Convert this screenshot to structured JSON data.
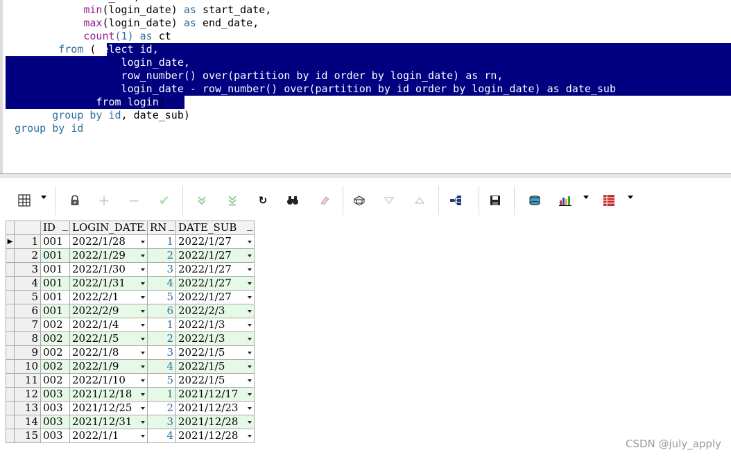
{
  "editor": {
    "lines": [
      {
        "segs": [
          {
            "t": "            date_sub,",
            "c": "tx"
          }
        ]
      },
      {
        "segs": [
          {
            "t": "            ",
            "c": "tx"
          },
          {
            "t": "min",
            "c": "fn"
          },
          {
            "t": "(login_date) ",
            "c": "tx"
          },
          {
            "t": "as",
            "c": "kw"
          },
          {
            "t": " start_date,",
            "c": "tx"
          }
        ]
      },
      {
        "segs": [
          {
            "t": "            ",
            "c": "tx"
          },
          {
            "t": "max",
            "c": "fn"
          },
          {
            "t": "(login_date) ",
            "c": "tx"
          },
          {
            "t": "as",
            "c": "kw"
          },
          {
            "t": " end_date,",
            "c": "tx"
          }
        ]
      },
      {
        "segs": [
          {
            "t": "            ",
            "c": "tx"
          },
          {
            "t": "count",
            "c": "fn"
          },
          {
            "t": "(1) ",
            "c": "num"
          },
          {
            "t": "as",
            "c": "kw"
          },
          {
            "t": " ct",
            "c": "tx"
          }
        ]
      },
      {
        "segs": [
          {
            "t": "        ",
            "c": "tx"
          },
          {
            "t": "from",
            "c": "kw"
          },
          {
            "t": " (",
            "c": "tx"
          },
          {
            "t": "select",
            "c": "kw"
          },
          {
            "t": " id,",
            "c": "tx"
          }
        ]
      },
      {
        "segs": [
          {
            "t": "                  login_date,",
            "c": "tx"
          }
        ]
      },
      {
        "segs": [
          {
            "t": "                  row_number() over(partition by id order by login_date) as rn,",
            "c": "tx"
          }
        ]
      },
      {
        "segs": [
          {
            "t": "                  login_date - row_number() over(partition by id order by login_date) as date_sub",
            "c": "tx"
          }
        ]
      },
      {
        "segs": [
          {
            "t": "              ",
            "c": "tx"
          },
          {
            "t": "from",
            "c": "kw"
          },
          {
            "t": " login)",
            "c": "tx"
          }
        ]
      },
      {
        "segs": [
          {
            "t": "       ",
            "c": "tx"
          },
          {
            "t": "group by",
            "c": "kw"
          },
          {
            "t": " ",
            "c": "tx"
          },
          {
            "t": "id",
            "c": "kw"
          },
          {
            "t": ", date_sub)",
            "c": "tx"
          }
        ]
      },
      {
        "segs": [
          {
            "t": " ",
            "c": "tx"
          },
          {
            "t": "group by",
            "c": "kw"
          },
          {
            "t": " ",
            "c": "tx"
          },
          {
            "t": "id",
            "c": "kw"
          }
        ]
      }
    ]
  },
  "toolbar": {
    "icons": [
      "grid-view-icon",
      "lock-icon",
      "add-record-icon",
      "delete-record-icon",
      "post-changes-icon",
      "fetch-next-icon",
      "fetch-last-icon",
      "refresh-icon",
      "find-icon",
      "clear-icon",
      "query-by-example-icon",
      "filter-down-icon",
      "filter-up-icon",
      "tree-view-icon",
      "save-icon",
      "export-icon",
      "chart-icon",
      "table-export-icon"
    ]
  },
  "grid": {
    "columns": [
      "ID",
      "LOGIN_DATE",
      "RN",
      "DATE_SUB"
    ],
    "rows": [
      {
        "n": "1",
        "id": "001",
        "login_date": "2022/1/28",
        "rn": "1",
        "date_sub": "2022/1/27"
      },
      {
        "n": "2",
        "id": "001",
        "login_date": "2022/1/29",
        "rn": "2",
        "date_sub": "2022/1/27"
      },
      {
        "n": "3",
        "id": "001",
        "login_date": "2022/1/30",
        "rn": "3",
        "date_sub": "2022/1/27"
      },
      {
        "n": "4",
        "id": "001",
        "login_date": "2022/1/31",
        "rn": "4",
        "date_sub": "2022/1/27"
      },
      {
        "n": "5",
        "id": "001",
        "login_date": "2022/2/1",
        "rn": "5",
        "date_sub": "2022/1/27"
      },
      {
        "n": "6",
        "id": "001",
        "login_date": "2022/2/9",
        "rn": "6",
        "date_sub": "2022/2/3"
      },
      {
        "n": "7",
        "id": "002",
        "login_date": "2022/1/4",
        "rn": "1",
        "date_sub": "2022/1/3"
      },
      {
        "n": "8",
        "id": "002",
        "login_date": "2022/1/5",
        "rn": "2",
        "date_sub": "2022/1/3"
      },
      {
        "n": "9",
        "id": "002",
        "login_date": "2022/1/8",
        "rn": "3",
        "date_sub": "2022/1/5"
      },
      {
        "n": "10",
        "id": "002",
        "login_date": "2022/1/9",
        "rn": "4",
        "date_sub": "2022/1/5"
      },
      {
        "n": "11",
        "id": "002",
        "login_date": "2022/1/10",
        "rn": "5",
        "date_sub": "2022/1/5"
      },
      {
        "n": "12",
        "id": "003",
        "login_date": "2021/12/18",
        "rn": "1",
        "date_sub": "2021/12/17"
      },
      {
        "n": "13",
        "id": "003",
        "login_date": "2021/12/25",
        "rn": "2",
        "date_sub": "2021/12/23"
      },
      {
        "n": "14",
        "id": "003",
        "login_date": "2021/12/31",
        "rn": "3",
        "date_sub": "2021/12/28"
      },
      {
        "n": "15",
        "id": "003",
        "login_date": "2022/1/1",
        "rn": "4",
        "date_sub": "2021/12/28"
      }
    ]
  },
  "watermark": "CSDN @july_apply",
  "colors": {
    "selection": "#000080",
    "keyword": "#2d6e9c",
    "function": "#9b1b8f",
    "alt_row": "#e6f8e6"
  }
}
